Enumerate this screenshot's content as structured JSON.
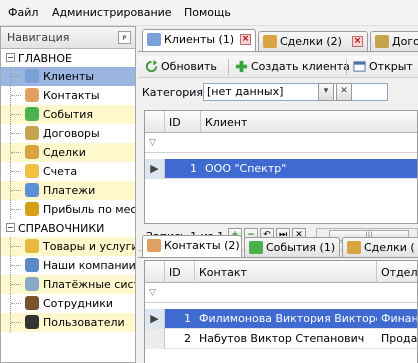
{
  "menu": [
    "Файл",
    "Администрирование",
    "Помощь"
  ],
  "nav": {
    "title": "Навигация",
    "pin_glyph": "ᴘ",
    "groups": [
      {
        "label": "ГЛАВНОЕ",
        "items": [
          {
            "label": "Клиенты",
            "icon": "clients-icon",
            "color": "#7aa0d8",
            "selected": true
          },
          {
            "label": "Контакты",
            "icon": "contact-icon",
            "color": "#e0a060"
          },
          {
            "label": "События",
            "icon": "clock-icon",
            "color": "#4caf50"
          },
          {
            "label": "Договоры",
            "icon": "contract-icon",
            "color": "#c4a44c"
          },
          {
            "label": "Сделки",
            "icon": "handshake-icon",
            "color": "#d9a441"
          },
          {
            "label": "Счета",
            "icon": "invoice-icon",
            "color": "#f0c040"
          },
          {
            "label": "Платежи",
            "icon": "payment-icon",
            "color": "#5c8fd6"
          },
          {
            "label": "Прибыль по месяцам",
            "icon": "coins-icon",
            "color": "#d4a017"
          }
        ]
      },
      {
        "label": "СПРАВОЧНИКИ",
        "items": [
          {
            "label": "Товары и услуги",
            "icon": "products-icon",
            "color": "#e6b840"
          },
          {
            "label": "Наши компании",
            "icon": "company-icon",
            "color": "#5b88c7"
          },
          {
            "label": "Платёжные системы",
            "icon": "payment-system-icon",
            "color": "#8aa9c9"
          },
          {
            "label": "Сотрудники",
            "icon": "employee-icon",
            "color": "#7a5230"
          },
          {
            "label": "Пользователи",
            "icon": "user-icon",
            "color": "#333333"
          }
        ]
      }
    ]
  },
  "top_tabs": [
    {
      "label": "Клиенты (1)",
      "icon": "clients-icon",
      "color": "#7aa0d8",
      "active": true
    },
    {
      "label": "Сделки (2)",
      "icon": "handshake-icon",
      "color": "#d9a441",
      "active": false
    },
    {
      "label": "Догово",
      "icon": "contract-icon",
      "color": "#c4a44c",
      "active": false
    }
  ],
  "toolbar": {
    "refresh": "Обновить",
    "create": "Создать клиента",
    "open": "Открыт"
  },
  "category": {
    "label": "Категория:",
    "value": "[нет данных]"
  },
  "clients_grid": {
    "columns": [
      "ID",
      "Клиент"
    ],
    "filter_glyph": "▽",
    "rows": [
      {
        "indicator": "▶",
        "id": "1",
        "name": "ООО \"Спектр\"",
        "selected": true
      }
    ]
  },
  "record_nav": {
    "text": "Запись 1 из 1",
    "buttons": [
      "+",
      "−",
      "↶",
      "⏭",
      "✕"
    ],
    "scroll_glyph": "|||"
  },
  "bottom_tabs": [
    {
      "label": "Контакты (2)",
      "icon": "contact-icon",
      "color": "#e0a060",
      "active": true
    },
    {
      "label": "События (1)",
      "icon": "clock-icon",
      "color": "#4caf50",
      "active": false
    },
    {
      "label": "Сделки (",
      "icon": "handshake-icon",
      "color": "#d9a441",
      "active": false
    }
  ],
  "contacts_grid": {
    "columns": [
      "ID",
      "Контакт",
      "Отдел"
    ],
    "filter_glyph": "▽",
    "rows": [
      {
        "indicator": "▶",
        "id": "1",
        "name": "Филимонова Виктория Викторовна",
        "dept": "Финансо",
        "selected": true
      },
      {
        "indicator": "",
        "id": "2",
        "name": "Набутов Виктор Степанович",
        "dept": "Продаж",
        "selected": false
      }
    ]
  }
}
